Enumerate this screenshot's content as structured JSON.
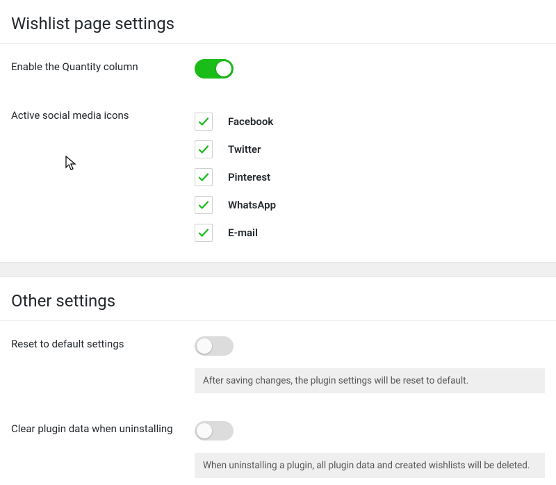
{
  "section1": {
    "title": "Wishlist page settings",
    "enable_quantity": {
      "label": "Enable the Quantity column",
      "on": true
    },
    "social": {
      "label": "Active social media icons",
      "items": [
        {
          "label": "Facebook",
          "checked": true
        },
        {
          "label": "Twitter",
          "checked": true
        },
        {
          "label": "Pinterest",
          "checked": true
        },
        {
          "label": "WhatsApp",
          "checked": true
        },
        {
          "label": "E-mail",
          "checked": true
        }
      ]
    }
  },
  "section2": {
    "title": "Other settings",
    "reset": {
      "label": "Reset to default settings",
      "on": false,
      "desc": "After saving changes, the plugin settings will be reset to default."
    },
    "clear": {
      "label": "Clear plugin data when uninstalling",
      "on": false,
      "desc": "When uninstalling a plugin, all plugin data and created wishlists will be deleted."
    }
  }
}
